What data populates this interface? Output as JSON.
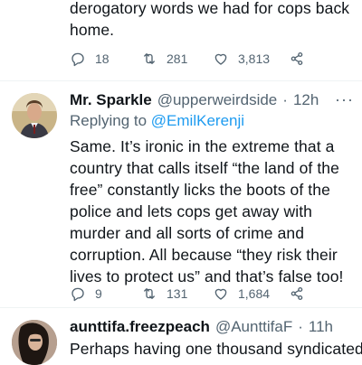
{
  "prev_tweet": {
    "text_lines": [
      "derogatory words we had for cops back",
      "home."
    ],
    "reply_count": "18",
    "retweet_count": "281",
    "like_count": "3,813"
  },
  "reply1": {
    "display_name": "Mr. Sparkle",
    "handle": "@upperweirdside",
    "time": "12h",
    "replying_label": "Replying to",
    "replying_to": "@EmilKerenji",
    "text_lines": [
      "Same. It’s ironic in the extreme that a",
      "country that calls itself “the land of the",
      "free” constantly licks the boots of the",
      "police and lets cops get away with",
      "murder and all sorts of crime and",
      "corruption. All because “they risk their",
      "lives to protect us” and that’s false too!"
    ],
    "reply_count": "9",
    "retweet_count": "131",
    "like_count": "1,684"
  },
  "reply2": {
    "display_name": "aunttifa.freezpeach",
    "handle": "@AunttifaF",
    "time": "11h",
    "text_lines": [
      "Perhaps having one thousand syndicated"
    ]
  },
  "ui": {
    "separator": "·",
    "more_glyph": "···",
    "link_color": "#1d9bf0",
    "muted_color": "#536471",
    "icons": [
      "reply-icon",
      "retweet-icon",
      "like-icon",
      "share-icon",
      "more-icon"
    ]
  }
}
